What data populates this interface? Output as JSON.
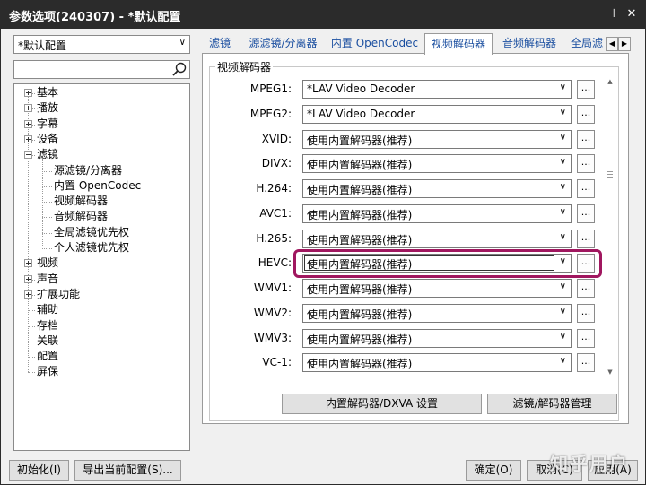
{
  "window": {
    "title": "参数选项(240307) - *默认配置",
    "pin_glyph": "⊣",
    "close_glyph": "✕"
  },
  "left_pane": {
    "profile_select": "*默认配置",
    "search_placeholder": "",
    "tree": [
      {
        "label": "基本",
        "level": 0,
        "toggle": "plus"
      },
      {
        "label": "播放",
        "level": 0,
        "toggle": "plus"
      },
      {
        "label": "字幕",
        "level": 0,
        "toggle": "plus"
      },
      {
        "label": "设备",
        "level": 0,
        "toggle": "plus"
      },
      {
        "label": "滤镜",
        "level": 0,
        "toggle": "minus"
      },
      {
        "label": "源滤镜/分离器",
        "level": 1
      },
      {
        "label": "内置 OpenCodec",
        "level": 1
      },
      {
        "label": "视频解码器",
        "level": 1
      },
      {
        "label": "音频解码器",
        "level": 1
      },
      {
        "label": "全局滤镜优先权",
        "level": 1
      },
      {
        "label": "个人滤镜优先权",
        "level": 1
      },
      {
        "label": "视频",
        "level": 0,
        "toggle": "plus"
      },
      {
        "label": "声音",
        "level": 0,
        "toggle": "plus"
      },
      {
        "label": "扩展功能",
        "level": 0,
        "toggle": "plus"
      },
      {
        "label": "辅助",
        "level": 0
      },
      {
        "label": "存档",
        "level": 0
      },
      {
        "label": "关联",
        "level": 0
      },
      {
        "label": "配置",
        "level": 0
      },
      {
        "label": "屏保",
        "level": 0
      }
    ]
  },
  "tabs": [
    {
      "label": "滤镜",
      "active": false
    },
    {
      "label": "源滤镜/分离器",
      "active": false
    },
    {
      "label": "内置 OpenCodec",
      "active": false
    },
    {
      "label": "视频解码器",
      "active": true
    },
    {
      "label": "音频解码器",
      "active": false
    },
    {
      "label": "全局滤",
      "active": false
    }
  ],
  "tab_arrows": {
    "left": "◀",
    "right": "▶"
  },
  "group_title": "视频解码器",
  "decoders": [
    {
      "format": "MPEG1:",
      "value": "*LAV Video Decoder"
    },
    {
      "format": "MPEG2:",
      "value": "*LAV Video Decoder"
    },
    {
      "format": "XVID:",
      "value": "使用内置解码器(推荐)"
    },
    {
      "format": "DIVX:",
      "value": "使用内置解码器(推荐)"
    },
    {
      "format": "H.264:",
      "value": "使用内置解码器(推荐)"
    },
    {
      "format": "AVC1:",
      "value": "使用内置解码器(推荐)"
    },
    {
      "format": "H.265:",
      "value": "使用内置解码器(推荐)"
    },
    {
      "format": "HEVC:",
      "value": "使用内置解码器(推荐)",
      "focused": true
    },
    {
      "format": "WMV1:",
      "value": "使用内置解码器(推荐)"
    },
    {
      "format": "WMV2:",
      "value": "使用内置解码器(推荐)"
    },
    {
      "format": "WMV3:",
      "value": "使用内置解码器(推荐)"
    },
    {
      "format": "VC-1:",
      "value": "使用内置解码器(推荐)"
    }
  ],
  "dots_label": "...",
  "combo_arrow": "∨",
  "content_buttons": {
    "dxva": "内置解码器/DXVA 设置",
    "manage": "滤镜/解码器管理"
  },
  "footer": {
    "init": "初始化(I)",
    "export": "导出当前配置(S)...",
    "ok": "确定(O)",
    "cancel": "取消(C)",
    "apply": "应用(A)"
  },
  "watermark": "知乎用户",
  "accent_colors": {
    "highlight": "#a0175f",
    "tab_text": "#1b4fa0",
    "titlebar": "#2b2b2b"
  }
}
